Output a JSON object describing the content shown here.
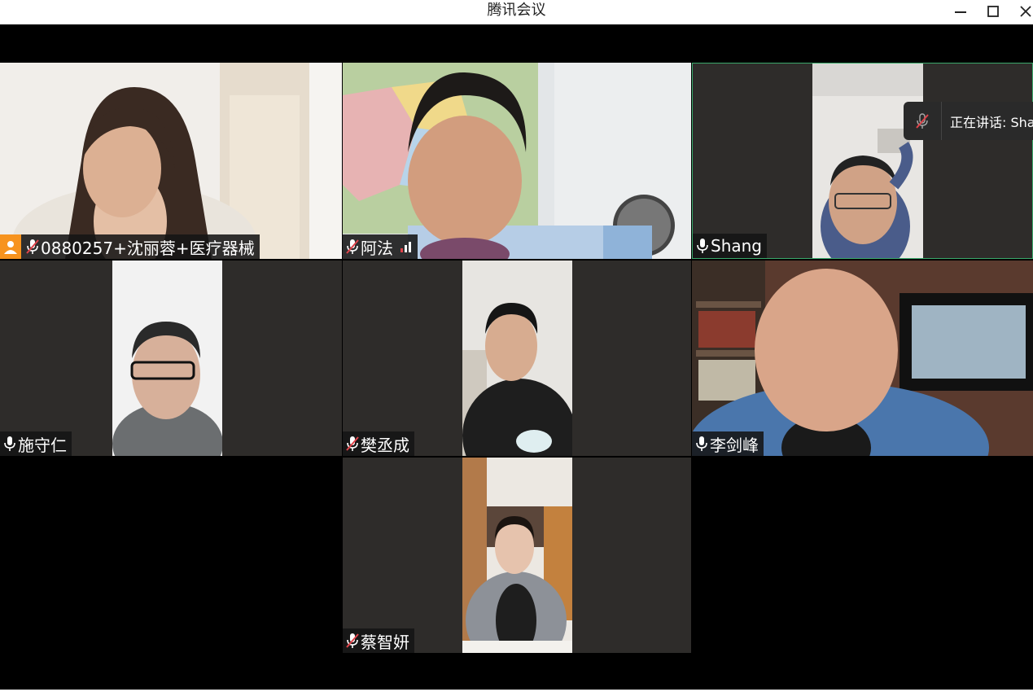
{
  "window": {
    "title": "腾讯会议"
  },
  "speaking": {
    "label": "正在讲话: Sha"
  },
  "participants": [
    {
      "name": "0880257+沈丽蓉+医疗器械",
      "mic": "muted",
      "host_badge": true
    },
    {
      "name": "阿法",
      "mic": "muted",
      "signal": true
    },
    {
      "name": "Shang",
      "mic": "on"
    },
    {
      "name": "施守仁",
      "mic": "on"
    },
    {
      "name": "樊丞成",
      "mic": "muted"
    },
    {
      "name": "李剑峰",
      "mic": "on"
    },
    {
      "name": "蔡智妍",
      "mic": "muted"
    }
  ],
  "colors": {
    "host_badge": "#f7931e",
    "signal": "#e0444b",
    "active_speaker_border": "#3aa86b"
  }
}
